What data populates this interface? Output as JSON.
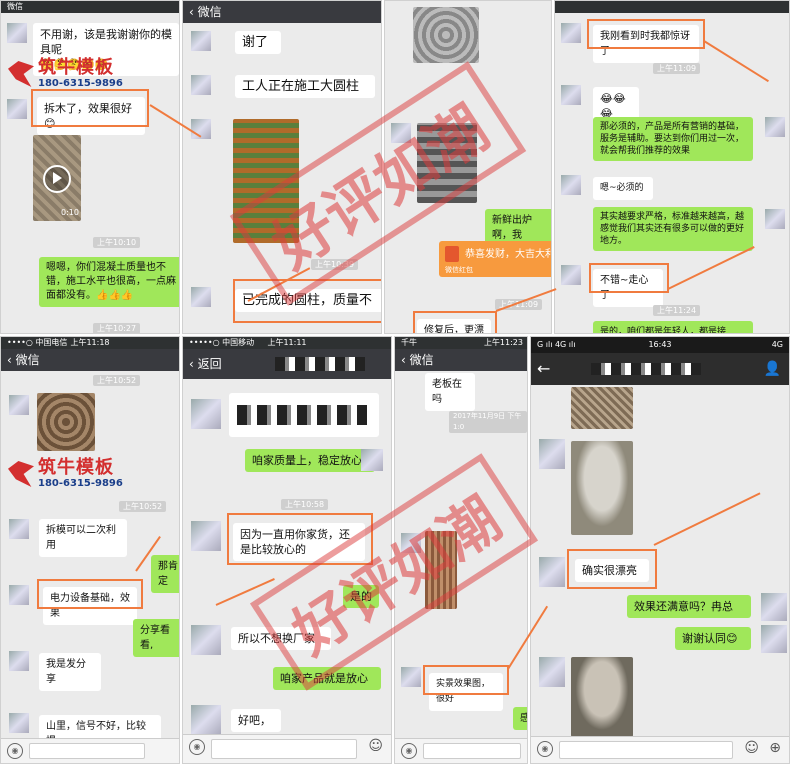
{
  "brand": {
    "name": "筑牛模板",
    "phone": "180-6315-9896",
    "color": "#d32f2f"
  },
  "watermark": "好评如潮",
  "accent_color": "#f07b3f",
  "panels": {
    "p1": {
      "status": "微信",
      "bubbles": [
        "不用谢，该是我谢谢你的模具呢",
        "🤔🤔🤔🤔🤔",
        "拆木了，效果很好 😊",
        "嗯嗯，你们混凝土质量也不错，施工水平也很高，一点麻面都没有。👍👍👍"
      ],
      "video_duration": "0:10",
      "times": [
        "上午10:10",
        "上午10:27"
      ]
    },
    "p2": {
      "nav": "微信",
      "bubbles": [
        "谢了",
        "工人正在施工大圆柱",
        "已完成的圆柱，质量不"
      ],
      "times": [
        "上午10:39"
      ]
    },
    "p3": {
      "bubbles": [
        "新鲜出炉啊，我",
        "修复后，更漂亮"
      ],
      "redpacket": "恭喜发财，大吉大利",
      "redpacket_sub": "微信红包",
      "times": [
        "上午11:09"
      ]
    },
    "p4": {
      "bubbles": [
        "我刚看到时我都惊讶了",
        "😂😂😂",
        "那必须的，产品是所有营销的基础，服务是辅助。要达到你们用过一次，就会帮我们推荐的效果",
        "嗯~必须的",
        "其实越要求严格，标准越来越高，越感觉我们其实还有很多可以做的更好地方。",
        "不错~走心了",
        "是的，咱们都是年轻人，都是接"
      ],
      "times": [
        "上午11:09",
        "上午11:24"
      ]
    },
    "p5": {
      "status_carrier": "••••○ 中国电信",
      "status_time": "上午11:18",
      "nav": "微信",
      "bubbles": [
        "拆模可以二次利用",
        "那肯定",
        "电力设备基础，效果",
        "分享看看,",
        "我是发分享",
        "山里，信号不好，比较慢"
      ],
      "times": [
        "上午10:52",
        "上午10:52"
      ]
    },
    "p6": {
      "status_carrier": "•••••○ 中国移动",
      "status_time": "上午11:11",
      "nav": "返回",
      "bubbles": [
        "咱家质量上，稳定放心",
        "因为一直用你家货，还是比较放心的",
        "是的",
        "所以不想换厂家",
        "咱家产品就是放心",
        "好吧，"
      ],
      "times": [
        "上午10:58"
      ]
    },
    "p7": {
      "status_carrier": "千牛",
      "status_time": "上午11:23",
      "nav": "微信",
      "bubbles": [
        "老板在吗",
        "实景效果图，很好",
        "感"
      ],
      "times": [
        "2017年11月9日 下午1:0"
      ]
    },
    "p8": {
      "status_left": "G ılı 4G ılı",
      "status_time": "16:43",
      "status_right": "4G",
      "bubbles": [
        "确实很漂亮",
        "效果还满意吗？冉总",
        "谢谢认同😊"
      ]
    }
  }
}
